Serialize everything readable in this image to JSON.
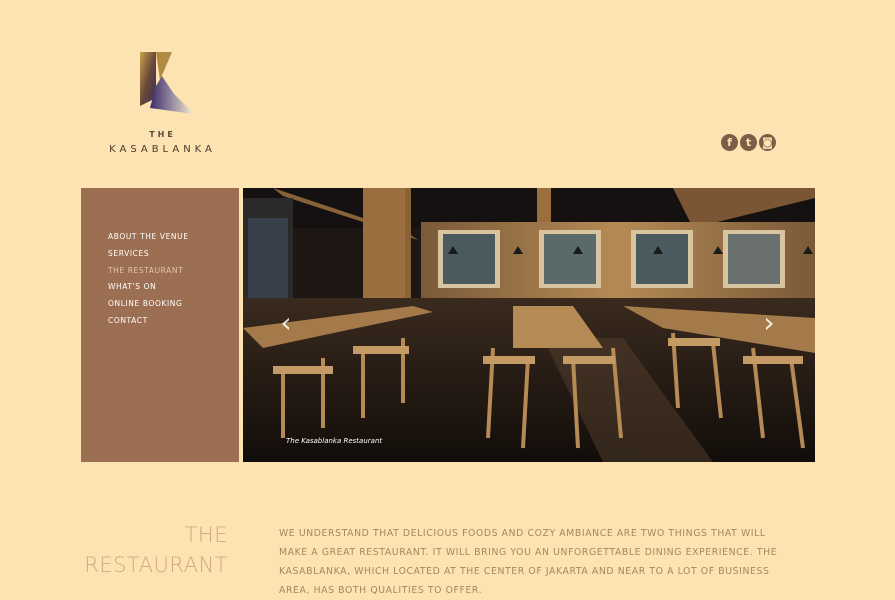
{
  "brand": {
    "the": "THE",
    "name": "KASABLANKA"
  },
  "social": [
    {
      "icon": "facebook-icon",
      "glyph": "f"
    },
    {
      "icon": "twitter-icon",
      "glyph": "t"
    },
    {
      "icon": "instagram-icon",
      "glyph": "◙"
    }
  ],
  "nav": {
    "items": [
      {
        "label": "ABOUT THE VENUE"
      },
      {
        "label": "SERVICES"
      },
      {
        "label": "THE RESTAURANT",
        "active": true
      },
      {
        "label": "WHAT'S ON"
      },
      {
        "label": "ONLINE BOOKING"
      },
      {
        "label": "CONTACT"
      }
    ]
  },
  "slider": {
    "caption": "The Kasablanka Restaurant",
    "prev": "‹",
    "next": "›"
  },
  "section": {
    "title_line1": "THE",
    "title_line2": "RESTAURANT",
    "body": "WE UNDERSTAND THAT DELICIOUS FOODS AND COZY AMBIANCE ARE TWO THINGS THAT WILL MAKE A GREAT RESTAURANT. IT WILL BRING YOU AN UNFORGETTABLE DINING EXPERIENCE. THE KASABLANKA, WHICH LOCATED AT THE CENTER OF JAKARTA AND NEAR TO A LOT OF BUSINESS AREA, HAS BOTH QUALITIES TO OFFER."
  },
  "colors": {
    "background": "#fde3b1",
    "sidebar": "#9c6f52",
    "accent": "#cfa883",
    "body_text": "#a8865f"
  }
}
